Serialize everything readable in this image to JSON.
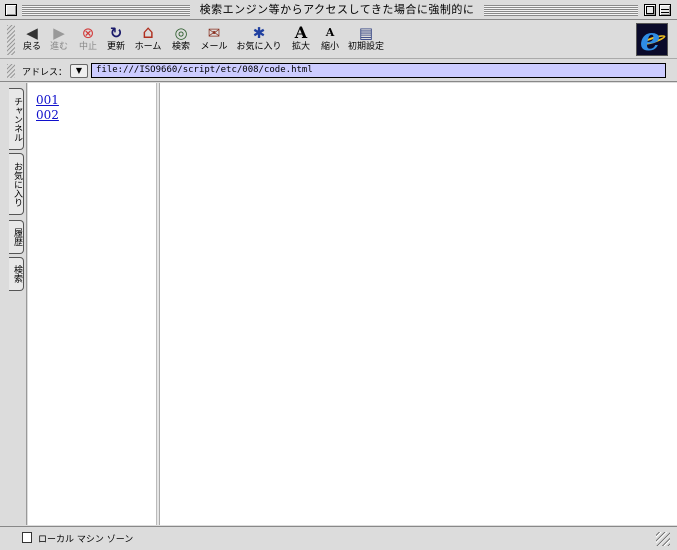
{
  "window": {
    "title": "検索エンジン等からアクセスしてきた場合に強制的に"
  },
  "toolbar": {
    "buttons": [
      {
        "label": "戻る",
        "icon": "back-arrow-icon",
        "glyph": "◀"
      },
      {
        "label": "進む",
        "icon": "forward-arrow-icon",
        "glyph": "▶"
      },
      {
        "label": "中止",
        "icon": "stop-icon",
        "glyph": "⊗"
      },
      {
        "label": "更新",
        "icon": "refresh-icon",
        "glyph": "↻"
      },
      {
        "label": "ホーム",
        "icon": "home-icon",
        "glyph": "⌂"
      },
      {
        "label": "検索",
        "icon": "search-icon",
        "glyph": "◎"
      },
      {
        "label": "メール",
        "icon": "mail-icon",
        "glyph": "✉"
      },
      {
        "label": "お気に入り",
        "icon": "favorites-icon",
        "glyph": "✱"
      },
      {
        "label": "拡大",
        "icon": "text-larger-icon",
        "glyph": "A"
      },
      {
        "label": "縮小",
        "icon": "text-smaller-icon",
        "glyph": "A"
      },
      {
        "label": "初期設定",
        "icon": "preferences-icon",
        "glyph": "▤"
      }
    ]
  },
  "address": {
    "label": "アドレス：",
    "value": "file:///ISO9660/script/etc/008/code.html"
  },
  "explorer_tabs": [
    "チャンネル",
    "お気に入り",
    "履歴",
    "検索"
  ],
  "left_frame": {
    "links": [
      "001",
      "002"
    ]
  },
  "status": {
    "zone": "ローカル マシン ゾーン"
  },
  "colors": {
    "address_bg": "#ccccff",
    "link": "#1010cc",
    "stop_icon": "#d23a3a",
    "ie_logo": "#2f8de4"
  }
}
